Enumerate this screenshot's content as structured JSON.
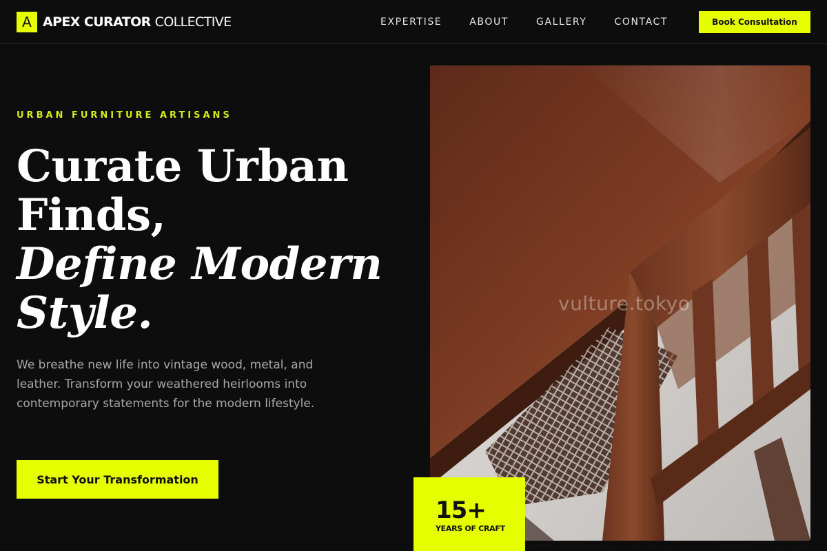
{
  "brand": {
    "mark": "A",
    "name_strong": "APEX CURATOR",
    "name_light": "COLLECTIVE"
  },
  "nav": {
    "links": [
      "EXPERTISE",
      "ABOUT",
      "GALLERY",
      "CONTACT"
    ],
    "cta": "Book Consultation"
  },
  "hero": {
    "eyebrow": "URBAN FURNITURE ARTISANS",
    "headline": {
      "line1": "Curate Urban",
      "line2": "Finds,",
      "line3": "Define Modern",
      "line4": "Style."
    },
    "body": "We breathe new life into vintage wood, metal, and leather. Transform your weathered heirlooms into contemporary statements for the modern lifestyle.",
    "cta": "Start Your Transformation",
    "image_watermark": "vulture.tokyo"
  },
  "stat": {
    "value": "15+",
    "label": "YEARS OF CRAFT"
  },
  "colors": {
    "background": "#0d0d0d",
    "accent": "#e5ff00",
    "eyebrow": "#d4ec1a",
    "body_text": "#a8a8a8"
  },
  "icons": {
    "brand_mark": "letter-a-logo-icon"
  }
}
